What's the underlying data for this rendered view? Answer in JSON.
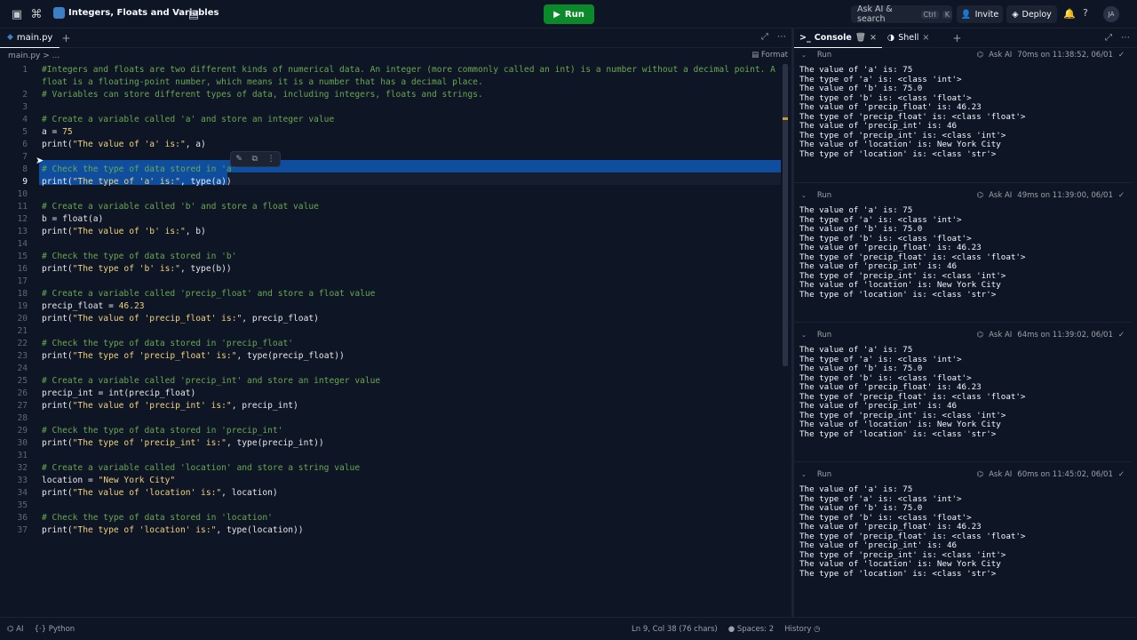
{
  "topbar": {
    "title": "Integers, Floats and Variables",
    "run_label": "Run",
    "search_label": "Ask AI & search",
    "search_kbd1": "Ctrl",
    "search_kbd2": "K",
    "invite_label": "Invite",
    "deploy_label": "Deploy",
    "avatar_initials": "JA"
  },
  "editor": {
    "tab_label": "main.py",
    "breadcrumb": "main.py > ...",
    "format_label": "Format",
    "current_line": 9,
    "lines": [
      {
        "n": "1",
        "text": "#Integers and floats are two different kinds of numerical data. An integer (more commonly called an int) is a number without a decimal point. A"
      },
      {
        "n": "",
        "text": "float is a floating-point number, which means it is a number that has a decimal place."
      },
      {
        "n": "2",
        "text": "# Variables can store different types of data, including integers, floats and strings."
      },
      {
        "n": "3",
        "text": ""
      },
      {
        "n": "4",
        "text": "# Create a variable called 'a' and store an integer value"
      },
      {
        "n": "5",
        "text": "a = 75"
      },
      {
        "n": "6",
        "text": "print(\"The value of 'a' is:\", a)"
      },
      {
        "n": "7",
        "text": ""
      },
      {
        "n": "8",
        "text": "# Check the type of data stored in 'a'"
      },
      {
        "n": "9",
        "text": "print(\"The type of 'a' is:\", type(a))"
      },
      {
        "n": "10",
        "text": ""
      },
      {
        "n": "11",
        "text": "# Create a variable called 'b' and store a float value"
      },
      {
        "n": "12",
        "text": "b = float(a)"
      },
      {
        "n": "13",
        "text": "print(\"The value of 'b' is:\", b)"
      },
      {
        "n": "14",
        "text": ""
      },
      {
        "n": "15",
        "text": "# Check the type of data stored in 'b'"
      },
      {
        "n": "16",
        "text": "print(\"The type of 'b' is:\", type(b))"
      },
      {
        "n": "17",
        "text": ""
      },
      {
        "n": "18",
        "text": "# Create a variable called 'precip_float' and store a float value"
      },
      {
        "n": "19",
        "text": "precip_float = 46.23"
      },
      {
        "n": "20",
        "text": "print(\"The value of 'precip_float' is:\", precip_float)"
      },
      {
        "n": "21",
        "text": ""
      },
      {
        "n": "22",
        "text": "# Check the type of data stored in 'precip_float'"
      },
      {
        "n": "23",
        "text": "print(\"The type of 'precip_float' is:\", type(precip_float))"
      },
      {
        "n": "24",
        "text": ""
      },
      {
        "n": "25",
        "text": "# Create a variable called 'precip_int' and store an integer value"
      },
      {
        "n": "26",
        "text": "precip_int = int(precip_float)"
      },
      {
        "n": "27",
        "text": "print(\"The value of 'precip_int' is:\", precip_int)"
      },
      {
        "n": "28",
        "text": ""
      },
      {
        "n": "29",
        "text": "# Check the type of data stored in 'precip_int'"
      },
      {
        "n": "30",
        "text": "print(\"The type of 'precip_int' is:\", type(precip_int))"
      },
      {
        "n": "31",
        "text": ""
      },
      {
        "n": "32",
        "text": "# Create a variable called 'location' and store a string value"
      },
      {
        "n": "33",
        "text": "location = \"New York City\""
      },
      {
        "n": "34",
        "text": "print(\"The value of 'location' is:\", location)"
      },
      {
        "n": "35",
        "text": ""
      },
      {
        "n": "36",
        "text": "# Check the type of data stored in 'location'"
      },
      {
        "n": "37",
        "text": "print(\"The type of 'location' is:\", type(location))"
      }
    ]
  },
  "console": {
    "tab_console": "Console",
    "tab_shell": "Shell",
    "runs": [
      {
        "label": "Run",
        "ask_ai": "Ask AI",
        "meta": "70ms on 11:38:52, 06/01"
      },
      {
        "label": "Run",
        "ask_ai": "Ask AI",
        "meta": "49ms on 11:39:00, 06/01"
      },
      {
        "label": "Run",
        "ask_ai": "Ask AI",
        "meta": "64ms on 11:39:02, 06/01"
      },
      {
        "label": "Run",
        "ask_ai": "Ask AI",
        "meta": "60ms on 11:45:02, 06/01"
      }
    ],
    "output_lines": [
      "The value of 'a' is: 75",
      "The type of 'a' is: <class 'int'>",
      "The value of 'b' is: 75.0",
      "The type of 'b' is: <class 'float'>",
      "The value of 'precip_float' is: 46.23",
      "The type of 'precip_float' is: <class 'float'>",
      "The value of 'precip_int' is: 46",
      "The type of 'precip_int' is: <class 'int'>",
      "The value of 'location' is: New York City",
      "The type of 'location' is: <class 'str'>"
    ]
  },
  "statusbar": {
    "ai_label": "AI",
    "language": "Python",
    "cursor_pos": "Ln 9, Col 38 (76 chars)",
    "spaces": "Spaces: 2",
    "history": "History"
  }
}
